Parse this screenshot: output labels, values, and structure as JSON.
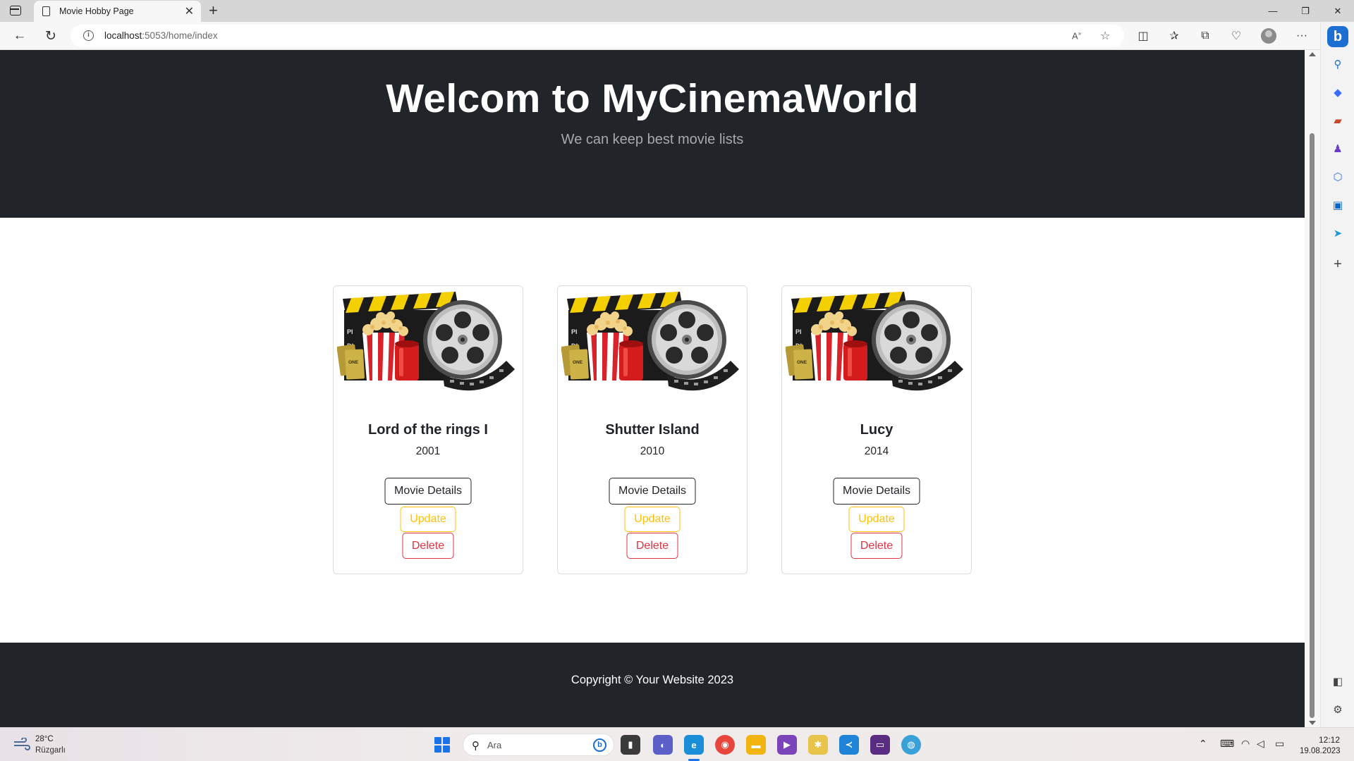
{
  "browser": {
    "tab_title": "Movie Hobby Page",
    "url_host": "localhost",
    "url_path": ":5053/home/index"
  },
  "hero": {
    "title": "Welcom to MyCinemaWorld",
    "subtitle": "We can keep best movie lists"
  },
  "movies": [
    {
      "title": "Lord of the rings I",
      "year": "2001",
      "details_label": "Movie Details",
      "update_label": "Update",
      "delete_label": "Delete"
    },
    {
      "title": "Shutter Island",
      "year": "2010",
      "details_label": "Movie Details",
      "update_label": "Update",
      "delete_label": "Delete"
    },
    {
      "title": "Lucy",
      "year": "2014",
      "details_label": "Movie Details",
      "update_label": "Update",
      "delete_label": "Delete"
    }
  ],
  "footer": {
    "text": "Copyright © Your Website 2023"
  },
  "taskbar": {
    "weather_temp": "28°C",
    "weather_desc": "Rüzgarlı",
    "search_placeholder": "Ara",
    "clock_time": "12:12",
    "clock_date": "19.08.2023"
  },
  "colors": {
    "dark": "#212529",
    "update": "#ffc107",
    "delete": "#dc3545",
    "accent": "#1a73e8"
  },
  "icons": {
    "tab": "page-icon",
    "back": "back-arrow-icon",
    "refresh": "refresh-icon",
    "site_info": "info-icon",
    "read_aloud": "read-aloud-icon",
    "favorite": "star-icon",
    "split_screen": "split-screen-icon",
    "favorites": "favorites-icon",
    "collections": "collections-icon",
    "browser_essentials": "heart-pulse-icon",
    "profile": "avatar-icon",
    "more": "more-icon",
    "copilot": "copilot-icon",
    "movie_image": "cinema-clapperboard-popcorn-film-reel-image"
  }
}
